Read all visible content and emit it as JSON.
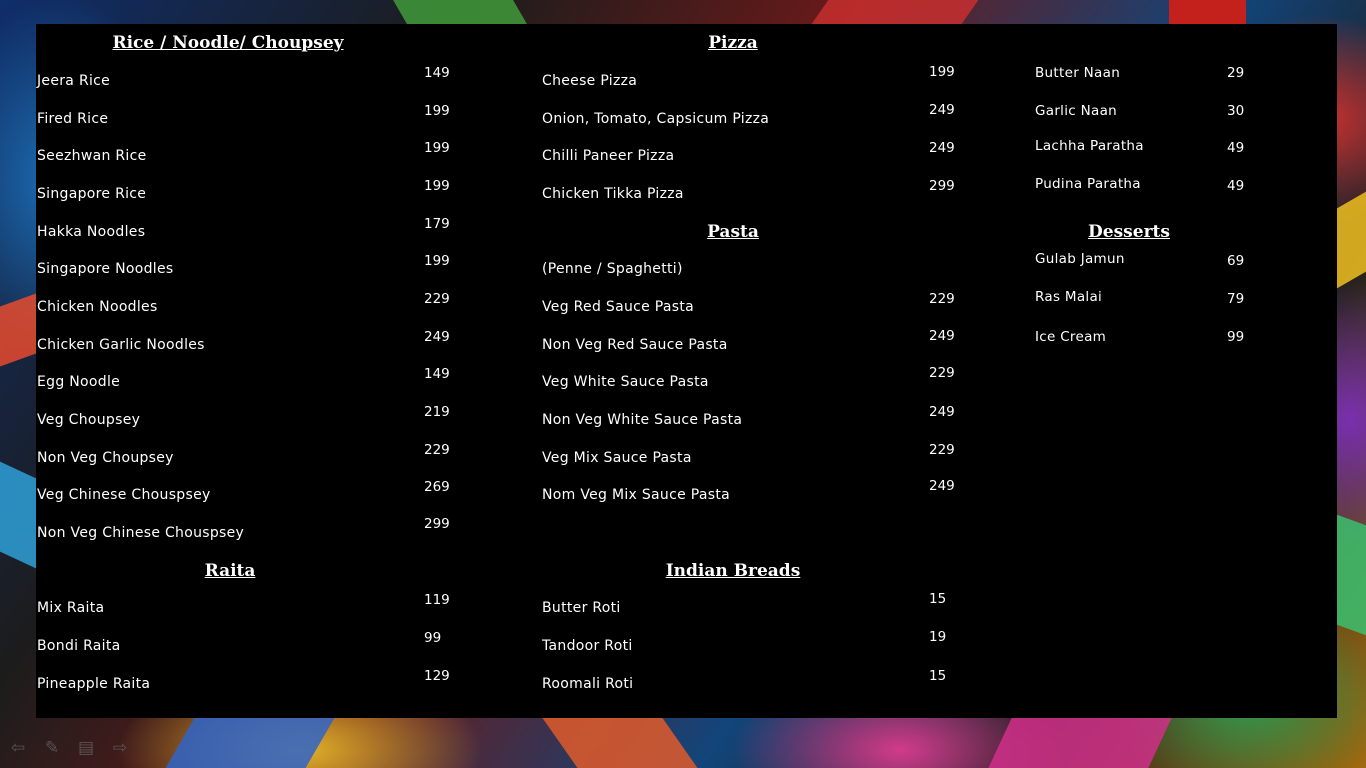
{
  "sections": {
    "rice": {
      "title": "Rice / Noodle/ Choupsey",
      "items": [
        {
          "name": "Jeera Rice",
          "price": "149"
        },
        {
          "name": "Fired Rice",
          "price": "199"
        },
        {
          "name": "Seezhwan Rice",
          "price": "199"
        },
        {
          "name": "Singapore Rice",
          "price": "199"
        },
        {
          "name": "Hakka Noodles",
          "price": "179"
        },
        {
          "name": "Singapore Noodles",
          "price": "199"
        },
        {
          "name": "Chicken Noodles",
          "price": "229"
        },
        {
          "name": "Chicken Garlic Noodles",
          "price": "249"
        },
        {
          "name": "Egg Noodle",
          "price": "149"
        },
        {
          "name": "Veg Choupsey",
          "price": "219"
        },
        {
          "name": "Non Veg Choupsey",
          "price": "229"
        },
        {
          "name": "Veg Chinese Chouspsey",
          "price": "269"
        },
        {
          "name": "Non Veg Chinese Chouspsey",
          "price": "299"
        }
      ]
    },
    "raita": {
      "title": "Raita",
      "items": [
        {
          "name": "Mix Raita",
          "price": "119"
        },
        {
          "name": "Bondi Raita",
          "price": "99"
        },
        {
          "name": "Pineapple Raita",
          "price": "129"
        }
      ]
    },
    "pizza": {
      "title": "Pizza",
      "items": [
        {
          "name": "Cheese Pizza",
          "price": "199"
        },
        {
          "name": "Onion, Tomato, Capsicum Pizza",
          "price": "249"
        },
        {
          "name": "Chilli Paneer  Pizza",
          "price": "249"
        },
        {
          "name": "Chicken Tikka Pizza",
          "price": "299"
        }
      ]
    },
    "pasta": {
      "title": "Pasta",
      "note": "(Penne / Spaghetti)",
      "items": [
        {
          "name": "Veg Red Sauce Pasta",
          "price": "229"
        },
        {
          "name": "Non Veg Red Sauce Pasta",
          "price": "249"
        },
        {
          "name": "Veg White Sauce Pasta",
          "price": "229"
        },
        {
          "name": "Non Veg White Sauce Pasta",
          "price": "249"
        },
        {
          "name": "Veg Mix Sauce Pasta",
          "price": "229"
        },
        {
          "name": "Nom Veg Mix Sauce Pasta",
          "price": "249"
        }
      ]
    },
    "breads": {
      "title": "Indian Breads",
      "items": [
        {
          "name": "Butter Roti",
          "price": "15"
        },
        {
          "name": "Tandoor Roti",
          "price": "19"
        },
        {
          "name": "Roomali Roti",
          "price": "15"
        }
      ]
    },
    "breads_cont": {
      "items": [
        {
          "name": "Butter Naan",
          "price": "29"
        },
        {
          "name": "Garlic Naan",
          "price": "30"
        },
        {
          "name": "Lachha Paratha",
          "price": "49"
        },
        {
          "name": "Pudina Paratha",
          "price": "49"
        }
      ]
    },
    "desserts": {
      "title": "Desserts",
      "items": [
        {
          "name": "Gulab Jamun",
          "price": "69"
        },
        {
          "name": "Ras Malai",
          "price": "79"
        },
        {
          "name": "Ice Cream",
          "price": "99"
        }
      ]
    }
  },
  "controls": {
    "prev_icon": "arrow-left-icon",
    "pen_icon": "pen-icon",
    "menu_icon": "menu-icon",
    "next_icon": "arrow-right-icon"
  }
}
